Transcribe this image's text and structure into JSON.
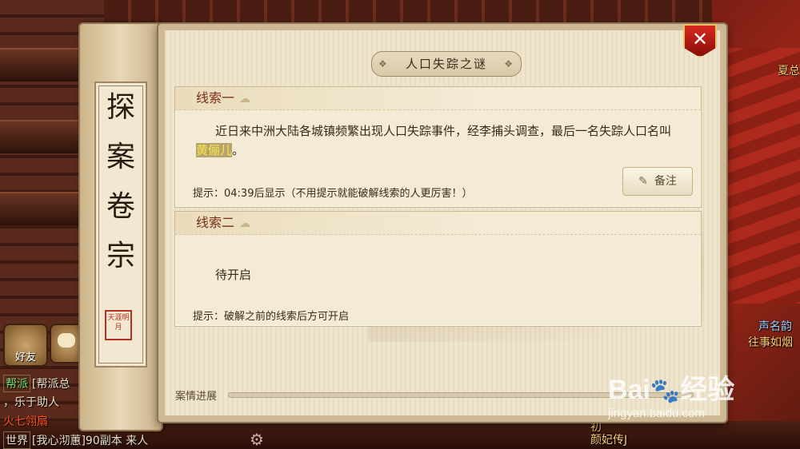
{
  "dialog": {
    "title": "人口失踪之谜",
    "close_label": "✕",
    "side_plaque": [
      "探",
      "案",
      "卷",
      "宗"
    ]
  },
  "clues": [
    {
      "header": "线索一",
      "text_before": "近日来中洲大陆各城镇频繁出现人口失踪事件，经李捕头调查，最后一名失踪人口名叫",
      "highlight": "黄俪儿",
      "text_after": "。",
      "hint": "提示：04:39后显示（不用提示就能破解线索的人更厉害！）",
      "note_label": "备注"
    },
    {
      "header": "线索二",
      "status": "待开启",
      "hint": "提示：破解之前的线索后方可开启"
    }
  ],
  "progress": {
    "label": "案情进展",
    "value": 0
  },
  "background": {
    "labels": [
      {
        "text": "夏总",
        "color": "gold"
      },
      {
        "text": "声名韵",
        "color": "blue"
      },
      {
        "text": "往事如烟",
        "color": "gold"
      },
      {
        "text": "颜妃传J",
        "color": "gold"
      },
      {
        "text": "初",
        "color": "gold"
      }
    ],
    "friend_label": "好友",
    "chat": [
      {
        "tag": "帮派",
        "text": "[帮派总"
      },
      {
        "tag": "",
        "text": "，乐于助人"
      },
      {
        "tag": "",
        "text": "火七翎扇",
        "red": true
      },
      {
        "tag": "世界",
        "text": "[我心沏蕙]90副本 来人"
      }
    ]
  },
  "watermark": {
    "logo": "Bai",
    "paw": "🐾",
    "logo2": "经验",
    "url": "jingyan.baidu.com"
  }
}
